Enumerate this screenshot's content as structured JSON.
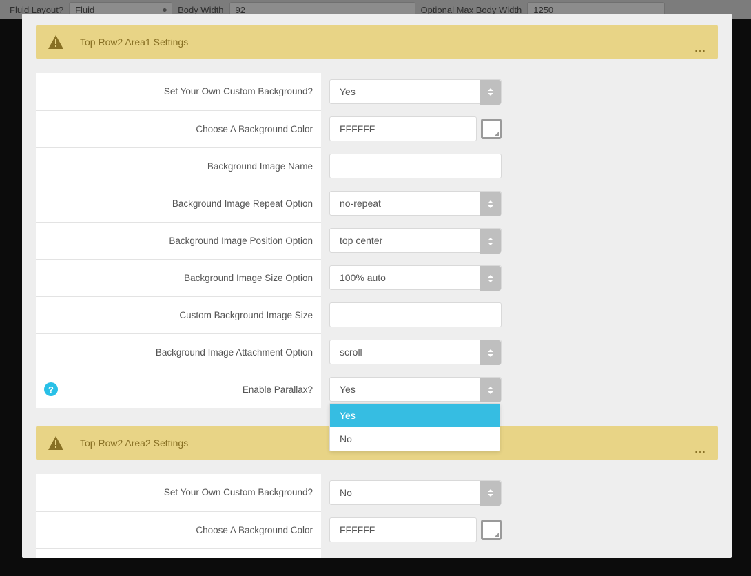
{
  "backdrop": {
    "fluid_layout_label": "Fluid Layout?",
    "fluid_layout_value": "Fluid",
    "body_width_label": "Body Width",
    "body_width_value": "92",
    "max_body_width_label": "Optional Max Body Width",
    "max_body_width_value": "1250"
  },
  "section1": {
    "title": "Top Row2 Area1 Settings",
    "rows": {
      "custom_bg_label": "Set Your Own Custom Background?",
      "custom_bg_value": "Yes",
      "bg_color_label": "Choose A Background Color",
      "bg_color_value": "FFFFFF",
      "bg_image_name_label": "Background Image Name",
      "bg_image_name_value": "",
      "bg_repeat_label": "Background Image Repeat Option",
      "bg_repeat_value": "no-repeat",
      "bg_position_label": "Background Image Position Option",
      "bg_position_value": "top center",
      "bg_size_label": "Background Image Size Option",
      "bg_size_value": "100% auto",
      "custom_size_label": "Custom Background Image Size",
      "custom_size_value": "",
      "bg_attach_label": "Background Image Attachment Option",
      "bg_attach_value": "scroll",
      "parallax_label": "Enable Parallax?",
      "parallax_value": "Yes",
      "parallax_options": {
        "yes": "Yes",
        "no": "No"
      }
    }
  },
  "section2": {
    "title": "Top Row2 Area2 Settings",
    "rows": {
      "custom_bg_label": "Set Your Own Custom Background?",
      "custom_bg_value": "No",
      "bg_color_label": "Choose A Background Color",
      "bg_color_value": "FFFFFF"
    }
  },
  "colors": {
    "header_bg": "#e8d486",
    "header_text": "#887024",
    "accent": "#36bde2"
  }
}
